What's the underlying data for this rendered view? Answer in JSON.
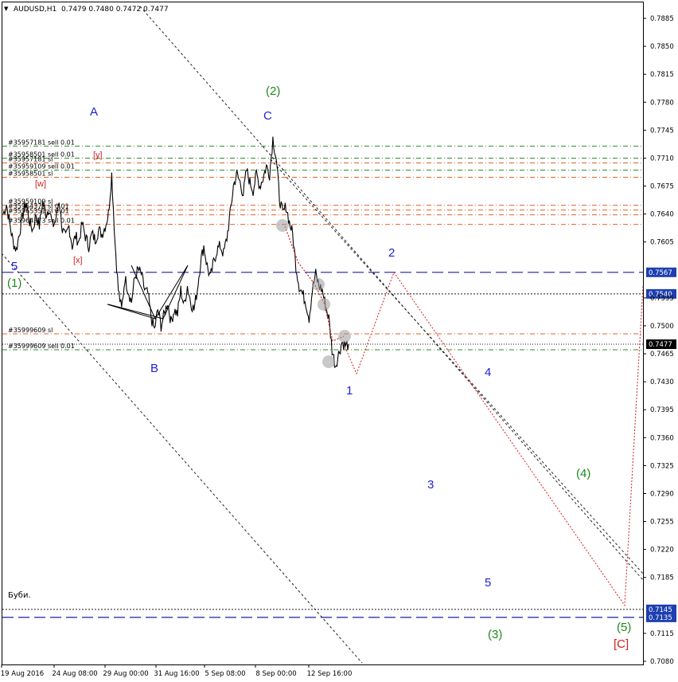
{
  "header": {
    "symbol": "AUDUSD,H1",
    "quotes": "0.7479 0.7480 0.7472 0.7477",
    "dropdown_glyph": "▼"
  },
  "colors": {
    "background": "#ffffff",
    "price": "#000000",
    "blue_label": "#1f1fd6",
    "green_label": "#1c8a1c",
    "red_label": "#d42020",
    "sl_line": "#e2602a",
    "sell_line": "#2e8b2e",
    "level_blue": "#1c1ca0",
    "level_dark": "#1a1a1a",
    "price_tag": "#1e3fb0"
  },
  "chart_data": {
    "type": "line",
    "title": "AUDUSD,H1",
    "ylim": [
      0.708,
      0.79
    ],
    "y_ticks": [
      "0.7885",
      "0.7850",
      "0.7815",
      "0.7780",
      "0.7745",
      "0.7710",
      "0.7675",
      "0.7640",
      "0.7605",
      "0.7535",
      "0.7500",
      "0.7465",
      "0.7430",
      "0.7395",
      "0.7360",
      "0.7325",
      "0.7290",
      "0.7255",
      "0.7220",
      "0.7185",
      "0.7115",
      "0.7080"
    ],
    "x_ticks": [
      "19 Aug 2016",
      "24 Aug 08:00",
      "29 Aug 00:00",
      "31 Aug 16:00",
      "5 Sep 08:00",
      "8 Sep 00:00",
      "12 Sep 16:00"
    ],
    "series": [
      {
        "values": [
          0.764,
          0.7652,
          0.7628,
          0.7605,
          0.7595,
          0.7618,
          0.764,
          0.7655,
          0.763,
          0.762,
          0.764,
          0.7625,
          0.7655,
          0.764,
          0.7648,
          0.7625,
          0.7632,
          0.7658,
          0.762,
          0.761,
          0.7625,
          0.76,
          0.7612,
          0.7605,
          0.7628,
          0.7612,
          0.76,
          0.7615,
          0.7608,
          0.762,
          0.7615,
          0.7625,
          0.764,
          0.769,
          0.7605,
          0.7545,
          0.752,
          0.756,
          0.7545,
          0.753,
          0.756,
          0.757,
          0.7565,
          0.7545,
          0.754,
          0.751,
          0.7495,
          0.752,
          0.75,
          0.7515,
          0.753,
          0.7505,
          0.752,
          0.7515,
          0.7545,
          0.7525,
          0.755,
          0.753,
          0.752,
          0.7545,
          0.758,
          0.76,
          0.7575,
          0.756,
          0.758,
          0.7595,
          0.76,
          0.759,
          0.761,
          0.764,
          0.7675,
          0.769,
          0.768,
          0.7665,
          0.7695,
          0.768,
          0.767,
          0.769,
          0.7675,
          0.7685,
          0.77,
          0.769,
          0.7735,
          0.771,
          0.766,
          0.764,
          0.765,
          0.763,
          0.7615,
          0.7575,
          0.755,
          0.754,
          0.753,
          0.751,
          0.7545,
          0.7565,
          0.755,
          0.7545,
          0.7525,
          0.751,
          0.747,
          0.745,
          0.7465,
          0.748,
          0.7475,
          0.7477
        ]
      }
    ],
    "sell_levels": [
      {
        "label": "#35957181 sell 0.01",
        "price": 0.7725
      },
      {
        "label": "#35958501 sell 0.01",
        "price": 0.771
      },
      {
        "label": "#35959109 sell 0.01",
        "price": 0.7695
      },
      {
        "label": "#35999609 sell 0.01",
        "price": 0.747
      }
    ],
    "sl_levels": [
      {
        "label": "#35957181 sl",
        "price": 0.7704
      },
      {
        "label": "#35958501 sl",
        "price": 0.7686
      },
      {
        "label": "#35959109 sl",
        "price": 0.7651
      },
      {
        "label": "#35964375 sl 0.01",
        "price": 0.7645
      },
      {
        "label": "#35965351 sl 0.01",
        "price": 0.7639
      },
      {
        "label": "#35964373 sell 0.01",
        "price": 0.7627
      },
      {
        "label": "#35999609 sl",
        "price": 0.749
      }
    ],
    "levels": [
      {
        "price": 0.7567,
        "label": "0.7567",
        "style": "long-dash",
        "color": "#1c1ca0"
      },
      {
        "price": 0.754,
        "label": "0.7540",
        "style": "dot",
        "color": "#1a1a1a"
      },
      {
        "price": 0.7477,
        "label": "0.7477",
        "style": "current",
        "color": "#1a1a1a"
      },
      {
        "price": 0.7145,
        "label": "0.7145",
        "style": "dot",
        "color": "#1a1a1a"
      },
      {
        "price": 0.7135,
        "label": "0.7135",
        "style": "long-dash",
        "color": "#1c1ca0"
      }
    ],
    "note": "Буби.",
    "wave_labels": {
      "blue": [
        "A",
        "B",
        "C",
        "1",
        "2",
        "3",
        "4",
        "5",
        "5"
      ],
      "green": [
        "(1)",
        "(2)",
        "(3)",
        "(4)",
        "(5)"
      ],
      "red_small": [
        "[w]",
        "[x]",
        "[y]"
      ],
      "red_big": [
        "[C]"
      ]
    },
    "projection_path": [
      0.7477,
      0.744,
      0.7567,
      0.715,
      0.755
    ]
  }
}
